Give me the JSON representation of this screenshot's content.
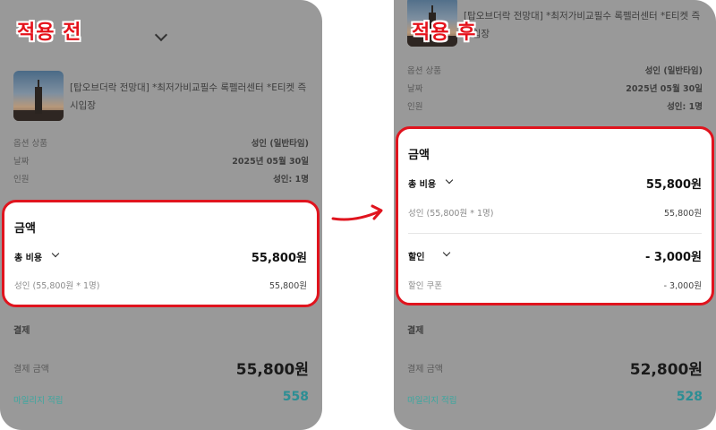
{
  "before": {
    "tag": "적용 전",
    "product_title_line1": "[탑오브더락 전망대] *최저가비교필수 록펠러센터 *E티켓 즉",
    "product_title_line2": "시입장",
    "info": [
      {
        "label": "옵션 상품",
        "value": "성인 (일반타임)"
      },
      {
        "label": "날짜",
        "value": "2025년 05월 30일"
      },
      {
        "label": "인원",
        "value": "성인: 1명"
      }
    ],
    "amount_heading": "금액",
    "total_label": "총 비용",
    "total_value": "55,800원",
    "detail_label": "성인 (55,800원 * 1명)",
    "detail_value": "55,800원",
    "payment_heading": "결제",
    "pay_amount_label": "결제 금액",
    "pay_amount_value": "55,800원",
    "mileage_label": "마일리지 적립",
    "mileage_value": "558"
  },
  "after": {
    "tag": "적용 후",
    "product_title_line1": "[탑오브더락 전망대] *최저가비교필수 록펠러센터 *E티켓 즉",
    "product_title_line2": "시입장",
    "info": [
      {
        "label": "옵션 상품",
        "value": "성인 (일반타임)"
      },
      {
        "label": "날짜",
        "value": "2025년 05월 30일"
      },
      {
        "label": "인원",
        "value": "성인: 1명"
      }
    ],
    "amount_heading": "금액",
    "total_label": "총 비용",
    "total_value": "55,800원",
    "detail_label": "성인 (55,800원 * 1명)",
    "detail_value": "55,800원",
    "discount_label": "할인",
    "discount_value": "- 3,000원",
    "coupon_label": "할인 쿠폰",
    "coupon_value": "- 3,000원",
    "payment_heading": "결제",
    "pay_amount_label": "결제 금액",
    "pay_amount_value": "52,800원",
    "mileage_label": "마일리지 적립",
    "mileage_value": "528"
  },
  "colors": {
    "highlight": "#e0141e",
    "overlay": "#999999",
    "mileage": "#2c8e94"
  }
}
